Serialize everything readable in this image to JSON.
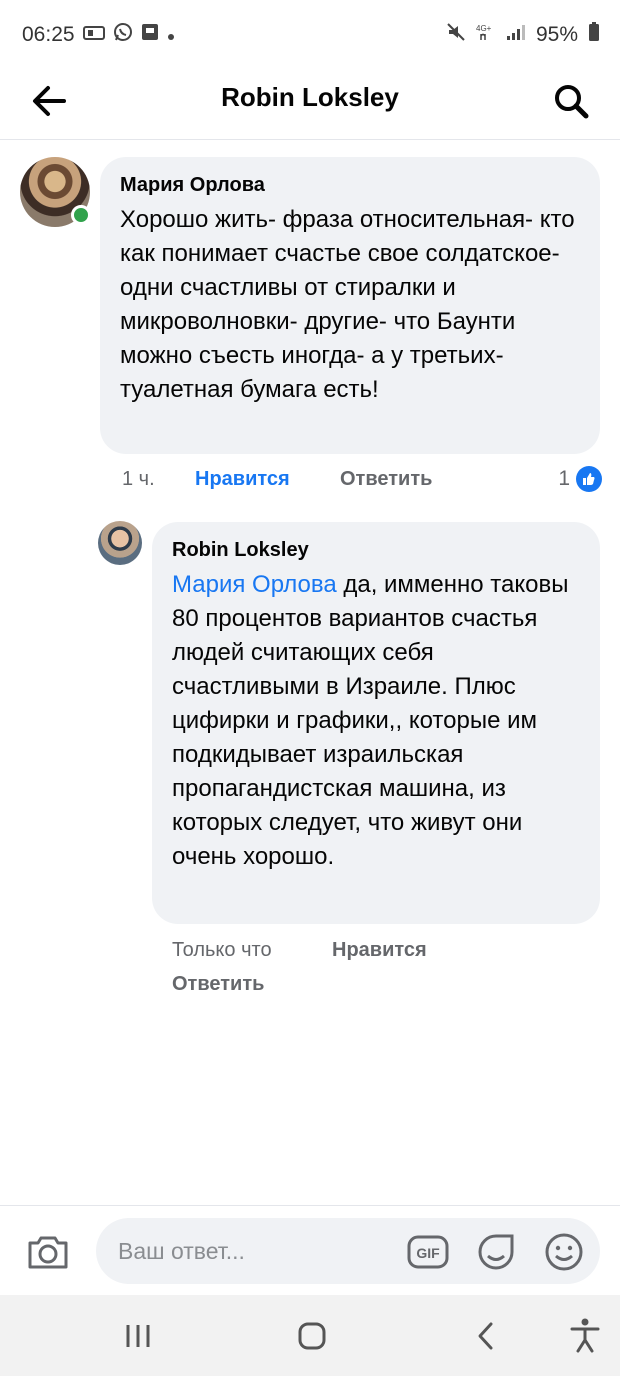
{
  "status_bar": {
    "time": "06:25",
    "battery": "95%",
    "left_icons": [
      "sim-card-icon",
      "whatsapp-icon",
      "gallery-icon",
      "dot-icon"
    ],
    "right_icons": [
      "mute-icon",
      "network-4g-icon",
      "signal-icon",
      "battery-icon"
    ]
  },
  "header": {
    "title": "Robin Loksley",
    "back_icon": "arrow-left-icon",
    "search_icon": "search-icon"
  },
  "comments": [
    {
      "author": "Мария Орлова",
      "text": "Хорошо жить- фраза относительная- кто как понимает счастье свое солдатское- одни счастливы от стиралки и микроволновки- другие- что Баунти можно съесть иногда- а у третьих- туалетная бумага есть!",
      "time": "1 ч.",
      "like_label": "Нравится",
      "reply_label": "Ответить",
      "reaction_count": "1",
      "online": true
    },
    {
      "author": "Robin Loksley",
      "mention": "Мария Орлова",
      "text": " да, имменно таковы 80 процентов вариантов счастья людей считающих себя счастливыми в Израиле. Плюс цифирки и графики,, которые им подкидывает израильская пропагандистская машина, из которых следует, что живут они очень хорошо.",
      "time": "Только что",
      "like_label": "Нравится",
      "reply_label": "Ответить"
    }
  ],
  "composer": {
    "placeholder": "Ваш ответ...",
    "value": "",
    "icons": [
      "camera-icon",
      "gif-icon",
      "sticker-icon",
      "emoji-icon"
    ]
  },
  "nav_bar": {
    "icons": [
      "recent-apps-icon",
      "home-icon",
      "back-icon",
      "accessibility-icon"
    ]
  },
  "colors": {
    "accent": "#1877f2",
    "bubble": "#f0f2f5",
    "secondary_text": "#65676b",
    "online": "#31a24c"
  }
}
